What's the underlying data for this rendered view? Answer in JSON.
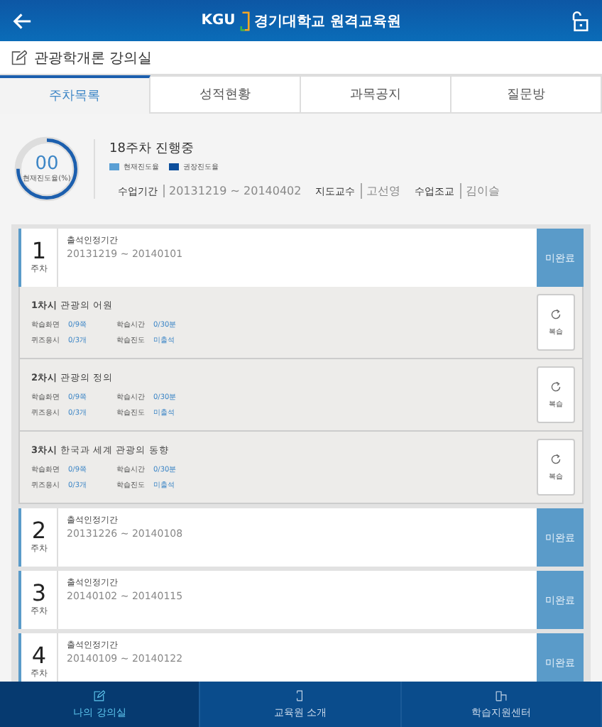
{
  "header": {
    "logo": "KGU",
    "title": "경기대학교 원격교육원"
  },
  "course": {
    "title": "관광학개론 강의실"
  },
  "tabs": [
    {
      "label": "주차목록",
      "selected": true
    },
    {
      "label": "성적현황",
      "selected": false
    },
    {
      "label": "과목공지",
      "selected": false
    },
    {
      "label": "질문방",
      "selected": false
    }
  ],
  "summary": {
    "progress": "00",
    "progress_label": "현재진도율(%)",
    "level": 0.75,
    "status": "18주차 진행중",
    "legend": [
      {
        "label": "현재진도율",
        "color": "#5a9fd4"
      },
      {
        "label": "권장진도율",
        "color": "#0d4f9c"
      }
    ],
    "info": [
      {
        "label": "수업기간",
        "value": "20131219 ~ 20140402"
      },
      {
        "label": "지도교수",
        "value": "고선영"
      },
      {
        "label": "수업조교",
        "value": "김이슬"
      }
    ]
  },
  "weeks": [
    {
      "number": "1",
      "unit": "주차",
      "period_label": "출석인정기간",
      "period": "20131219 ~ 20140101",
      "status": "미완료",
      "lessons": [
        {
          "title": "**1차시** 관광의 어원",
          "stats": [
            {
              "label": "학습화면",
              "value": "0/9쪽"
            },
            {
              "label": "학습시간",
              "value": "0/30분"
            },
            {
              "label": "퀴즈응시",
              "value": "0/3개"
            },
            {
              "label": "학습진도",
              "value": "미출석"
            }
          ],
          "button": "복습"
        },
        {
          "title": "**2차시** 관광의 정의",
          "stats": [
            {
              "label": "학습화면",
              "value": "0/9쪽"
            },
            {
              "label": "학습시간",
              "value": "0/30분"
            },
            {
              "label": "퀴즈응시",
              "value": "0/3개"
            },
            {
              "label": "학습진도",
              "value": "미출석"
            }
          ],
          "button": "복습"
        },
        {
          "title": "**3차시** 한국과 세계 관광의 동향",
          "stats": [
            {
              "label": "학습화면",
              "value": "0/9쪽"
            },
            {
              "label": "학습시간",
              "value": "0/30분"
            },
            {
              "label": "퀴즈응시",
              "value": "0/3개"
            },
            {
              "label": "학습진도",
              "value": "미출석"
            }
          ],
          "button": "복습"
        }
      ]
    },
    {
      "number": "2",
      "unit": "주차",
      "period_label": "출석인정기간",
      "period": "20131226 ~ 20140108",
      "status": "미완료"
    },
    {
      "number": "3",
      "unit": "주차",
      "period_label": "출석인정기간",
      "period": "20140102 ~ 20140115",
      "status": "미완료"
    },
    {
      "number": "4",
      "unit": "주차",
      "period_label": "출석인정기간",
      "period": "20140109 ~ 20140122",
      "status": "미완료"
    }
  ],
  "nav": [
    {
      "label": "나의 강의실",
      "selected": true
    },
    {
      "label": "교육원 소개",
      "selected": false
    },
    {
      "label": "학습지원센터",
      "selected": false
    }
  ]
}
